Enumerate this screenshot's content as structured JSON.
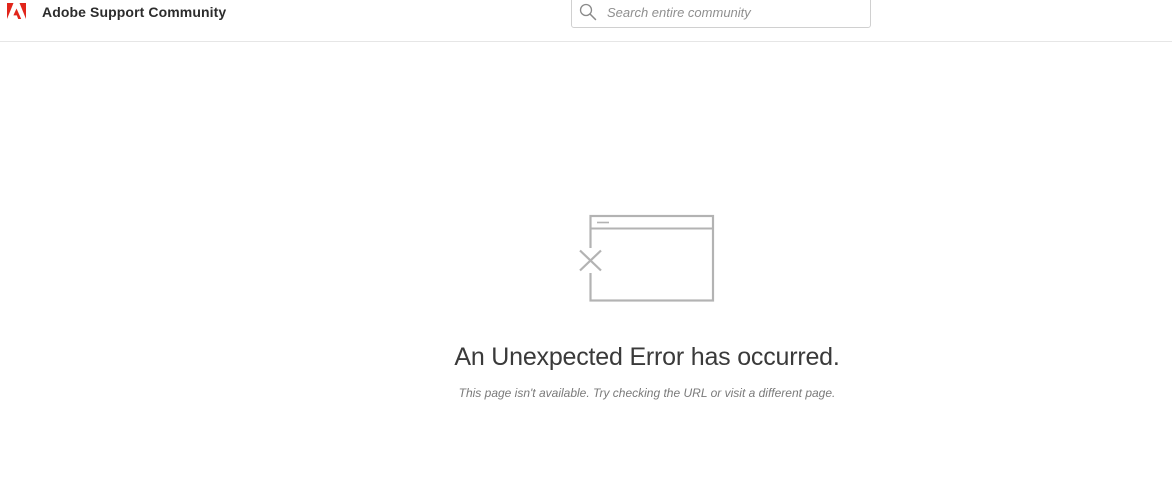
{
  "header": {
    "site_title": "Adobe Support Community",
    "logo_icon": "adobe-logo-icon",
    "brand_color": "#e1251b"
  },
  "search": {
    "placeholder": "Search entire community",
    "value": "",
    "icon": "search-icon"
  },
  "error": {
    "illustration_icon": "broken-window-icon",
    "heading": "An Unexpected Error has occurred.",
    "message": "This page isn't available. Try checking the URL or visit a different page."
  }
}
